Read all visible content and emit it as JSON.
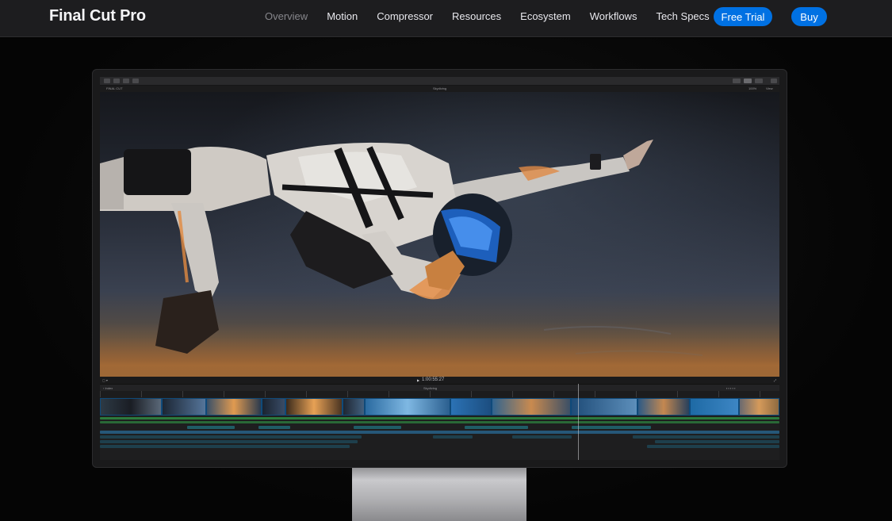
{
  "nav": {
    "brand": "Final Cut Pro",
    "links": [
      "Overview",
      "Motion",
      "Compressor",
      "Resources",
      "Ecosystem",
      "Workflows",
      "Tech Specs"
    ],
    "active_link": "Overview",
    "free_trial_label": "Free Trial",
    "buy_label": "Buy",
    "accent_color": "#0071e3"
  },
  "fcp": {
    "viewer_title": "Skydiving",
    "library_label": "FINAL CUT",
    "zoom_label": "100%",
    "view_label": "View",
    "timecode": "1:00:55:27",
    "project_label": "Skydiving"
  }
}
